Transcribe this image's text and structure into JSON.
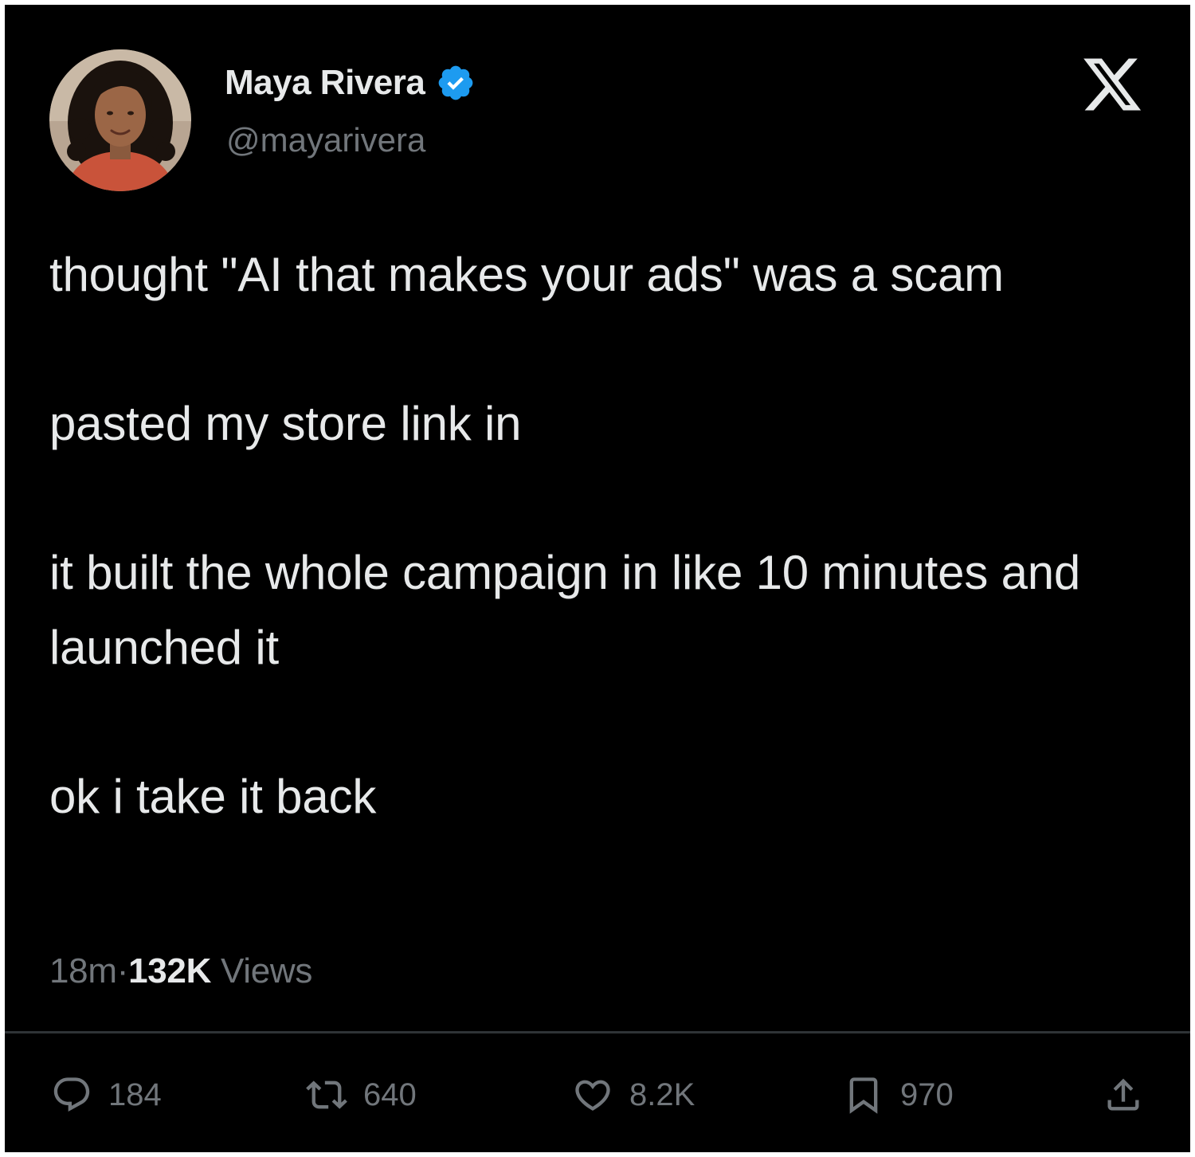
{
  "author": {
    "display_name": "Maya Rivera",
    "handle": "@mayarivera",
    "verified": true
  },
  "tweet": {
    "paragraphs": [
      "thought \"AI that makes your ads\" was a scam",
      "pasted my store link in",
      "it built the whole campaign in like 10 minutes and launched it",
      "ok i take it back"
    ],
    "time": "18m",
    "separator": "·",
    "views_count": "132K",
    "views_label": "Views"
  },
  "actions": {
    "replies": "184",
    "reposts": "640",
    "likes": "8.2K",
    "bookmarks": "970"
  },
  "colors": {
    "background": "#000000",
    "text": "#e7e9ea",
    "secondary_text": "#71767b",
    "verified_badge": "#1d9bf0",
    "divider": "#2f3336"
  },
  "icons": {
    "logo": "x-logo-icon",
    "verified": "verified-badge-icon",
    "reply": "reply-icon",
    "repost": "repost-icon",
    "like": "heart-icon",
    "bookmark": "bookmark-icon",
    "share": "share-icon"
  }
}
